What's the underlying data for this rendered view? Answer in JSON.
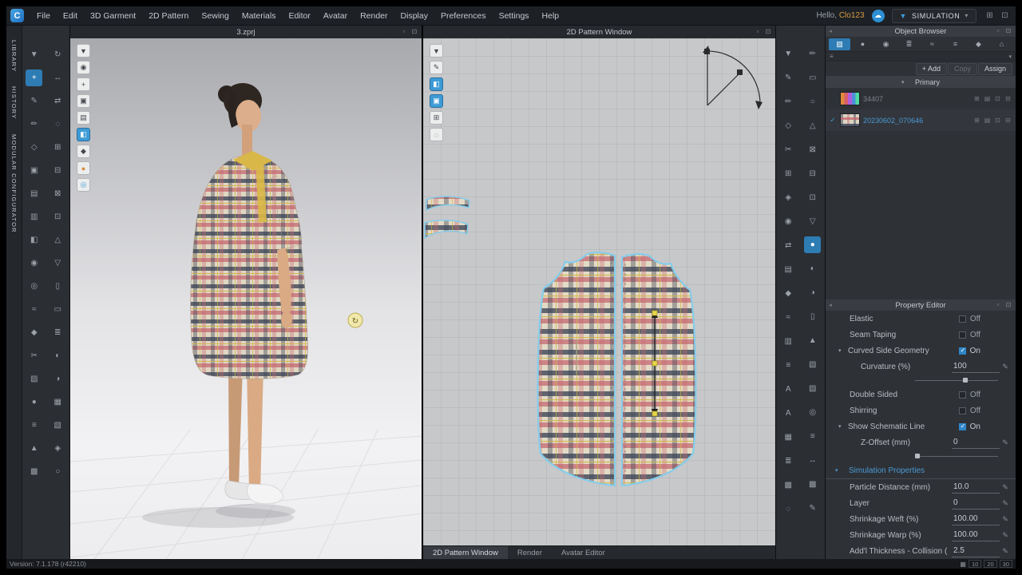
{
  "menu": {
    "items": [
      "File",
      "Edit",
      "3D Garment",
      "2D Pattern",
      "Sewing",
      "Materials",
      "Editor",
      "Avatar",
      "Render",
      "Display",
      "Preferences",
      "Settings",
      "Help"
    ],
    "greeting_prefix": "Hello,",
    "username": "Clo123",
    "simulation_label": "SIMULATION"
  },
  "sidebar_tabs": [
    "LIBRARY",
    "HISTORY",
    "MODULAR CONFIGURATOR"
  ],
  "viewport_3d": {
    "title": "3.zprj"
  },
  "viewport_2d": {
    "title": "2D Pattern Window"
  },
  "bottom_tabs": [
    "2D Pattern Window",
    "Render",
    "Avatar Editor"
  ],
  "object_browser": {
    "title": "Object Browser",
    "add_button": "+ Add",
    "copy_button": "Copy",
    "assign_button": "Assign",
    "section_title": "Primary",
    "fabrics": [
      {
        "name": "34407",
        "selected": false
      },
      {
        "name": "20230602_070646",
        "selected": true
      }
    ]
  },
  "property_editor": {
    "title": "Property Editor",
    "elastic": {
      "label": "Elastic",
      "value": "Off"
    },
    "seam_taping": {
      "label": "Seam Taping",
      "value": "Off"
    },
    "curved_side_geometry": {
      "label": "Curved Side Geometry",
      "value": "On"
    },
    "curvature": {
      "label": "Curvature (%)",
      "value": "100"
    },
    "double_sided": {
      "label": "Double Sided",
      "value": "Off"
    },
    "shirring": {
      "label": "Shirring",
      "value": "Off"
    },
    "show_schematic_line": {
      "label": "Show Schematic Line",
      "value": "On"
    },
    "z_offset": {
      "label": "Z-Offset (mm)",
      "value": "0"
    },
    "simulation_section": {
      "label": "Simulation Properties"
    },
    "particle_distance": {
      "label": "Particle Distance (mm)",
      "value": "10.0"
    },
    "layer": {
      "label": "Layer",
      "value": "0"
    },
    "shrinkage_weft": {
      "label": "Shrinkage Weft (%)",
      "value": "100.00"
    },
    "shrinkage_warp": {
      "label": "Shrinkage Warp (%)",
      "value": "100.00"
    },
    "addl_thickness": {
      "label": "Add'l Thickness - Collision (",
      "value": "2.5"
    }
  },
  "status_bar": {
    "version": "Version: 7.1.178 (r42210)",
    "zoom_levels": [
      "10",
      "20",
      "30"
    ]
  },
  "colors": {
    "accent": "#3d9bd6",
    "plaid_navy": "#3f4658",
    "plaid_rose": "#c46870",
    "plaid_cream": "#e3dac6",
    "collar_yellow": "#d9b748"
  },
  "icons": {
    "left_col1": [
      {
        "name": "select-move-tool-icon",
        "glyph": "▼"
      },
      {
        "name": "transform-pattern-tool-icon",
        "glyph": "+",
        "active": true
      },
      {
        "name": "edit-pattern-tool-icon",
        "glyph": "✎"
      },
      {
        "name": "edit-curvature-tool-icon",
        "glyph": "✏"
      },
      {
        "name": "add-point-tool-icon",
        "glyph": "◇"
      },
      {
        "name": "pen-tool-icon",
        "glyph": "▣"
      },
      {
        "name": "segment-sewing-tool-icon",
        "glyph": "▤"
      },
      {
        "name": "free-sewing-tool-icon",
        "glyph": "▥"
      },
      {
        "name": "fold-arrangement-tool-icon",
        "glyph": "◧"
      },
      {
        "name": "pin-tool-icon",
        "glyph": "◉"
      },
      {
        "name": "tack-on-avatar-tool-icon",
        "glyph": "◎"
      },
      {
        "name": "steam-brush-tool-icon",
        "glyph": "≈"
      },
      {
        "name": "measure-tool-icon",
        "glyph": "◆"
      },
      {
        "name": "scissors-tool-icon",
        "glyph": "✂"
      },
      {
        "name": "fabric-texture-tool-icon",
        "glyph": "▨"
      },
      {
        "name": "button-tool-icon",
        "glyph": "●"
      },
      {
        "name": "zipper-tool-icon",
        "glyph": "≡"
      },
      {
        "name": "dart-tool-icon",
        "glyph": "▲"
      },
      {
        "name": "shade-tool-icon",
        "glyph": "▩"
      }
    ],
    "left_col2": [
      {
        "name": "rotate-view-icon",
        "glyph": "↻"
      },
      {
        "name": "pan-view-icon",
        "glyph": "↔"
      },
      {
        "name": "scale-view-icon",
        "glyph": "⇄"
      },
      {
        "name": "smooth-tool-icon",
        "glyph": "◌"
      },
      {
        "name": "stitch-tool-icon",
        "glyph": "⊞"
      },
      {
        "name": "topstitch-tool-icon",
        "glyph": "⊟"
      },
      {
        "name": "shirring-tool-icon",
        "glyph": "⊠"
      },
      {
        "name": "grading-tool-icon",
        "glyph": "⊡"
      },
      {
        "name": "notch-tool-icon",
        "glyph": "△"
      },
      {
        "name": "flattening-tool-icon",
        "glyph": "▽"
      },
      {
        "name": "seam-allowance-tool-icon",
        "glyph": "▯"
      },
      {
        "name": "pattern-outline-tool-icon",
        "glyph": "▭"
      },
      {
        "name": "pleat-tool-icon",
        "glyph": "≣"
      },
      {
        "name": "binding-tool-icon",
        "glyph": "◐"
      },
      {
        "name": "piping-tool-icon",
        "glyph": "◑"
      },
      {
        "name": "puckering-tool-icon",
        "glyph": "▦"
      },
      {
        "name": "print-layout-tool-icon",
        "glyph": "▧"
      },
      {
        "name": "uv-map-tool-icon",
        "glyph": "◈"
      },
      {
        "name": "annotation-tool-icon",
        "glyph": "○"
      }
    ],
    "vp3d_tools": [
      {
        "name": "view-mode-icon",
        "glyph": "▼"
      },
      {
        "name": "show-avatar-icon",
        "glyph": "◉"
      },
      {
        "name": "zoom-extents-icon",
        "glyph": "+"
      },
      {
        "name": "show-garment-icon",
        "glyph": "▣"
      },
      {
        "name": "surface-texture-icon",
        "glyph": "▤"
      },
      {
        "name": "show-internal-lines-icon",
        "glyph": "◧",
        "active": true
      },
      {
        "name": "show-seamlines-icon",
        "glyph": "◆"
      },
      {
        "name": "avatar-texture-icon",
        "glyph": "●",
        "color": "#d98a3d"
      },
      {
        "name": "show-environment-icon",
        "glyph": "◎",
        "color": "#3d9bd6"
      }
    ],
    "vp2d_tools": [
      {
        "name": "pattern-view-mode-icon",
        "glyph": "▼"
      },
      {
        "name": "show-pattern-info-icon",
        "glyph": "✎"
      },
      {
        "name": "show-sewing-lines-icon",
        "glyph": "◧",
        "active": true
      },
      {
        "name": "show-fabric-texture-icon",
        "glyph": "▣",
        "active": true
      },
      {
        "name": "show-base-pattern-icon",
        "glyph": "⊞"
      },
      {
        "name": "show-grid-icon",
        "glyph": "◌"
      }
    ],
    "right_col1": [
      {
        "name": "transform-2d-icon",
        "glyph": "▼"
      },
      {
        "name": "edit-pattern-2d-icon",
        "glyph": "✎"
      },
      {
        "name": "edit-curvature-2d-icon",
        "glyph": "✏"
      },
      {
        "name": "add-point-2d-icon",
        "glyph": "◇"
      },
      {
        "name": "trace-icon",
        "glyph": "✂"
      },
      {
        "name": "grainline-icon",
        "glyph": "⊞"
      },
      {
        "name": "internal-polygon-icon",
        "glyph": "◈"
      },
      {
        "name": "internal-circle-icon",
        "glyph": "◉"
      },
      {
        "name": "symmetry-icon",
        "glyph": "⇄"
      },
      {
        "name": "dart-2d-icon",
        "glyph": "▤"
      },
      {
        "name": "notch-2d-icon",
        "glyph": "◆"
      },
      {
        "name": "elastic-2d-icon",
        "glyph": "≈"
      },
      {
        "name": "seam-allowance-2d-icon",
        "glyph": "▥"
      },
      {
        "name": "internal-line-icon",
        "glyph": "≡"
      },
      {
        "name": "pattern-annotation-icon",
        "glyph": "A"
      },
      {
        "name": "pattern-text-icon",
        "glyph": "A"
      },
      {
        "name": "grading-2d-icon",
        "glyph": "▦"
      },
      {
        "name": "pleats-2d-icon",
        "glyph": "≣"
      },
      {
        "name": "hatch-fill-icon",
        "glyph": "▩"
      },
      {
        "name": "circle-tool-2d-icon",
        "glyph": "◌"
      }
    ],
    "right_col2": [
      {
        "name": "pen-2d-icon",
        "glyph": "✏"
      },
      {
        "name": "rectangle-pattern-icon",
        "glyph": "▭"
      },
      {
        "name": "circle-pattern-icon",
        "glyph": "○"
      },
      {
        "name": "polygon-pattern-icon",
        "glyph": "△"
      },
      {
        "name": "cut-and-sew-icon",
        "glyph": "⊠"
      },
      {
        "name": "segment-sewing-2d-icon",
        "glyph": "⊟"
      },
      {
        "name": "free-sewing-2d-icon",
        "glyph": "⊡"
      },
      {
        "name": "sewing-direction-icon",
        "glyph": "▽"
      },
      {
        "name": "edit-sewing-icon",
        "glyph": "●",
        "active": true
      },
      {
        "name": "detach-sewing-icon",
        "glyph": "◐"
      },
      {
        "name": "fold-line-icon",
        "glyph": "◑"
      },
      {
        "name": "tape-icon",
        "glyph": "▯"
      },
      {
        "name": "fullness-icon",
        "glyph": "▲"
      },
      {
        "name": "track-pattern-icon",
        "glyph": "▧"
      },
      {
        "name": "layer-clone-icon",
        "glyph": "▨"
      },
      {
        "name": "buttonhole-2d-icon",
        "glyph": "◎"
      },
      {
        "name": "zipper-2d-icon",
        "glyph": "≡"
      },
      {
        "name": "measure-2d-icon",
        "glyph": "↔"
      },
      {
        "name": "texture-edit-2d-icon",
        "glyph": "▩"
      },
      {
        "name": "comment-2d-icon",
        "glyph": "✎"
      }
    ],
    "ob_tabs": [
      {
        "name": "fabric-tab-icon",
        "glyph": "▨",
        "active": true
      },
      {
        "name": "button-tab-icon",
        "glyph": "●"
      },
      {
        "name": "buttonhole-tab-icon",
        "glyph": "◉"
      },
      {
        "name": "topstitch-tab-icon",
        "glyph": "≣"
      },
      {
        "name": "puckering-tab-icon",
        "glyph": "≈"
      },
      {
        "name": "zipper-tab-icon",
        "glyph": "≡"
      },
      {
        "name": "trim-tab-icon",
        "glyph": "◆"
      },
      {
        "name": "avatar-tab-icon",
        "glyph": "⌂"
      }
    ],
    "fabric_actions": [
      {
        "name": "fabric-grid-icon",
        "glyph": "⊞"
      },
      {
        "name": "fabric-detail-icon",
        "glyph": "▤"
      },
      {
        "name": "fabric-clone-icon",
        "glyph": "⊡"
      },
      {
        "name": "fabric-remove-icon",
        "glyph": "⊟"
      }
    ],
    "window_controls": [
      {
        "name": "viewport-float-icon",
        "glyph": "▫"
      },
      {
        "name": "viewport-maximize-icon",
        "glyph": "⊡"
      }
    ],
    "ob_header_icons": [
      {
        "name": "panel-float-icon",
        "glyph": "▫"
      },
      {
        "name": "panel-maximize-icon",
        "glyph": "⊡"
      }
    ],
    "menubar_right": [
      {
        "name": "workspace-layout-icon",
        "glyph": "⊞"
      },
      {
        "name": "fullscreen-icon",
        "glyph": "⊡"
      }
    ],
    "status_icons": [
      {
        "name": "snap-grid-icon",
        "glyph": "▦"
      }
    ]
  }
}
